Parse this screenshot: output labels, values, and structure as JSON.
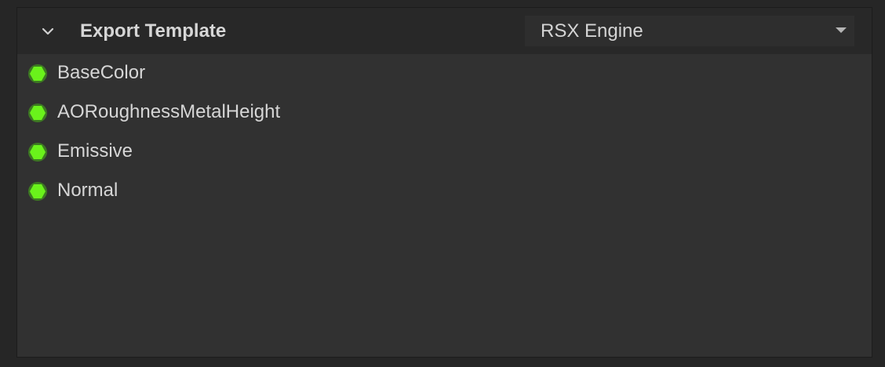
{
  "panel": {
    "title": "Export Template",
    "expanded": true,
    "toggle_icon": "chevron-down-icon",
    "dropdown": {
      "selected": "RSX Engine",
      "arrow_icon": "caret-down-icon"
    }
  },
  "channels": [
    {
      "label": "BaseColor",
      "status_icon": "hexagon-status-icon",
      "status_color": "#6af21b"
    },
    {
      "label": "AORoughnessMetalHeight",
      "status_icon": "hexagon-status-icon",
      "status_color": "#6af21b"
    },
    {
      "label": "Emissive",
      "status_icon": "hexagon-status-icon",
      "status_color": "#6af21b"
    },
    {
      "label": "Normal",
      "status_icon": "hexagon-status-icon",
      "status_color": "#6af21b"
    }
  ]
}
